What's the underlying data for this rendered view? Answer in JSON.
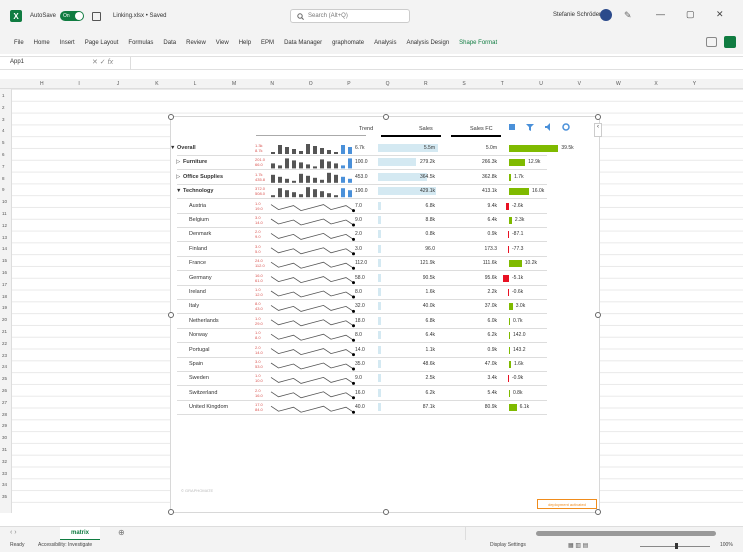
{
  "window": {
    "autosave_label": "AutoSave",
    "toggle_state": "On",
    "filename": "Linking.xlsx • Saved",
    "search_placeholder": "Search (Alt+Q)",
    "user_name": "Stefanie Schröder"
  },
  "menu": [
    "File",
    "Home",
    "Insert",
    "Page Layout",
    "Formulas",
    "Data",
    "Review",
    "View",
    "Help",
    "EPM",
    "Data Manager",
    "graphomate",
    "Analysis",
    "Analysis Design",
    "Shape Format"
  ],
  "menu_active": "Shape Format",
  "namebox": "App1",
  "fx_label": "fx",
  "columns": [
    "H",
    "I",
    "J",
    "K",
    "L",
    "M",
    "N",
    "O",
    "P",
    "Q",
    "R",
    "S",
    "T",
    "U",
    "V",
    "W",
    "X",
    "Y"
  ],
  "rows": [
    "1",
    "2",
    "3",
    "4",
    "5",
    "6",
    "7",
    "8",
    "9",
    "10",
    "11",
    "12",
    "13",
    "14",
    "15",
    "16",
    "17",
    "18",
    "19",
    "20",
    "21",
    "22",
    "23",
    "24",
    "25",
    "26",
    "27",
    "28",
    "29",
    "30",
    "31",
    "32",
    "33",
    "34",
    "35"
  ],
  "table": {
    "headers": {
      "trend": "Trend",
      "sales": "Sales",
      "sales_fc": "Sales FC"
    },
    "rows": [
      {
        "label": "Overall",
        "mini": [
          "1.3k",
          "8.7k"
        ],
        "trend": "6.7k",
        "sales": "5.5m",
        "fc": "5.0m",
        "dev": "39.5k",
        "level": 0,
        "bold": true
      },
      {
        "label": "Furniture",
        "mini": [
          "201.0",
          "66.0"
        ],
        "trend": "100.0",
        "sales": "279.2k",
        "fc": "266.3k",
        "dev": "12.9k",
        "level": 1,
        "bold": true
      },
      {
        "label": "Office Supplies",
        "mini": [
          "1.7k",
          "435.8"
        ],
        "trend": "453.0",
        "sales": "364.5k",
        "fc": "362.8k",
        "dev": "1.7k",
        "level": 1,
        "bold": true
      },
      {
        "label": "Technology",
        "mini": [
          "372.0",
          "508.0"
        ],
        "trend": "190.0",
        "sales": "429.1k",
        "fc": "413.1k",
        "dev": "16.0k",
        "level": 1,
        "bold": true
      },
      {
        "label": "Austria",
        "mini": [
          "1.0",
          "19.0"
        ],
        "trend": "7.0",
        "sales": "6.8k",
        "fc": "9.4k",
        "dev": "-2.6k",
        "level": 2
      },
      {
        "label": "Belgium",
        "mini": [
          "3.0",
          "14.0"
        ],
        "trend": "9.0",
        "sales": "8.8k",
        "fc": "6.4k",
        "dev": "2.3k",
        "level": 2
      },
      {
        "label": "Denmark",
        "mini": [
          "2.0",
          "9.0"
        ],
        "trend": "2.0",
        "sales": "0.8k",
        "fc": "0.9k",
        "dev": "-87.1",
        "level": 2
      },
      {
        "label": "Finland",
        "mini": [
          "3.0",
          "5.0"
        ],
        "trend": "3.0",
        "sales": "96.0",
        "fc": "173.3",
        "dev": "-77.3",
        "level": 2
      },
      {
        "label": "France",
        "mini": [
          "24.0",
          "112.0"
        ],
        "trend": "112.0",
        "sales": "121.9k",
        "fc": "111.6k",
        "dev": "10.2k",
        "level": 2
      },
      {
        "label": "Germany",
        "mini": [
          "16.0",
          "61.0"
        ],
        "trend": "58.0",
        "sales": "90.5k",
        "fc": "95.6k",
        "dev": "-5.1k",
        "level": 2
      },
      {
        "label": "Ireland",
        "mini": [
          "1.0",
          "12.0"
        ],
        "trend": "8.0",
        "sales": "1.6k",
        "fc": "2.2k",
        "dev": "-0.6k",
        "level": 2
      },
      {
        "label": "Italy",
        "mini": [
          "8.0",
          "43.0"
        ],
        "trend": "32.0",
        "sales": "40.0k",
        "fc": "37.0k",
        "dev": "3.0k",
        "level": 2
      },
      {
        "label": "Netherlands",
        "mini": [
          "1.0",
          "29.0"
        ],
        "trend": "18.0",
        "sales": "6.8k",
        "fc": "6.0k",
        "dev": "0.7k",
        "level": 2
      },
      {
        "label": "Norway",
        "mini": [
          "1.0",
          "8.0"
        ],
        "trend": "8.0",
        "sales": "6.4k",
        "fc": "6.2k",
        "dev": "142.0",
        "level": 2
      },
      {
        "label": "Portugal",
        "mini": [
          "2.0",
          "14.0"
        ],
        "trend": "14.0",
        "sales": "1.1k",
        "fc": "0.9k",
        "dev": "143.2",
        "level": 2
      },
      {
        "label": "Spain",
        "mini": [
          "3.0",
          "53.0"
        ],
        "trend": "35.0",
        "sales": "48.6k",
        "fc": "47.0k",
        "dev": "1.6k",
        "level": 2
      },
      {
        "label": "Sweden",
        "mini": [
          "1.0",
          "10.0"
        ],
        "trend": "9.0",
        "sales": "2.5k",
        "fc": "3.4k",
        "dev": "-0.9k",
        "level": 2
      },
      {
        "label": "Switzerland",
        "mini": [
          "2.0",
          "16.0"
        ],
        "trend": "16.0",
        "sales": "6.2k",
        "fc": "5.4k",
        "dev": "0.8k",
        "level": 2
      },
      {
        "label": "United Kingdom",
        "mini": [
          "17.0",
          "84.0"
        ],
        "trend": "40.0",
        "sales": "87.1k",
        "fc": "80.9k",
        "dev": "6.1k",
        "level": 2
      }
    ]
  },
  "watermark": "© GRAPHOMATE",
  "orange_button": "deployment activated",
  "sheet_tab": "matrix",
  "status": {
    "ready": "Ready",
    "accessibility": "Accessibility: Investigate",
    "display": "Display Settings",
    "zoom": "100%"
  },
  "colors": {
    "green": "#107c41",
    "bar_pos": "#7fba00",
    "bar_neg": "#e81123",
    "fill": "#d4e9f2",
    "toolbar_blue": "#4a90d9"
  }
}
